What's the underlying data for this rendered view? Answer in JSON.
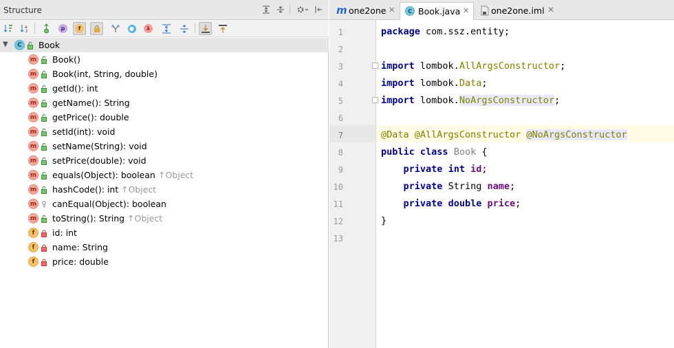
{
  "structure": {
    "title": "Structure",
    "header_tools": [
      "expand-icon",
      "collapse-icon",
      "settings-icon",
      "hide-icon"
    ],
    "toolbar": [
      "sort-visibility-icon",
      "sort-alpha-icon",
      "show-inherited-icon",
      "show-properties-icon",
      "show-fields-icon",
      "show-non-public-icon",
      "show-anonymous-icon",
      "show-lambdas-icon",
      "autoscroll-to-source-icon",
      "autoscroll-from-source-icon",
      "expand-all-icon",
      "collapse-all-icon"
    ],
    "tree": {
      "class_name": "Book",
      "members": [
        {
          "kind": "m",
          "label": "Book()",
          "inherited": "",
          "visibility": "public"
        },
        {
          "kind": "m",
          "label": "Book(int, String, double)",
          "inherited": "",
          "visibility": "public"
        },
        {
          "kind": "m",
          "label": "getId(): int",
          "inherited": "",
          "visibility": "public"
        },
        {
          "kind": "m",
          "label": "getName(): String",
          "inherited": "",
          "visibility": "public"
        },
        {
          "kind": "m",
          "label": "getPrice(): double",
          "inherited": "",
          "visibility": "public"
        },
        {
          "kind": "m",
          "label": "setId(int): void",
          "inherited": "",
          "visibility": "public"
        },
        {
          "kind": "m",
          "label": "setName(String): void",
          "inherited": "",
          "visibility": "public"
        },
        {
          "kind": "m",
          "label": "setPrice(double): void",
          "inherited": "",
          "visibility": "public"
        },
        {
          "kind": "m",
          "label": "equals(Object): boolean",
          "inherited": "↑Object",
          "visibility": "public"
        },
        {
          "kind": "m",
          "label": "hashCode(): int",
          "inherited": "↑Object",
          "visibility": "public"
        },
        {
          "kind": "m",
          "label": "canEqual(Object): boolean",
          "inherited": "",
          "visibility": "protected"
        },
        {
          "kind": "m",
          "label": "toString(): String",
          "inherited": "↑Object",
          "visibility": "public"
        },
        {
          "kind": "f",
          "label": "id: int",
          "inherited": "",
          "visibility": "private"
        },
        {
          "kind": "f",
          "label": "name: String",
          "inherited": "",
          "visibility": "private"
        },
        {
          "kind": "f",
          "label": "price: double",
          "inherited": "",
          "visibility": "private"
        }
      ]
    }
  },
  "editor": {
    "tabs": [
      {
        "label": "one2one",
        "icon": "m",
        "active": false
      },
      {
        "label": "Book.java",
        "icon": "c",
        "active": true
      },
      {
        "label": "one2one.iml",
        "icon": "file",
        "active": false
      }
    ],
    "line_numbers": [
      "1",
      "2",
      "3",
      "4",
      "5",
      "6",
      "7",
      "8",
      "9",
      "10",
      "11",
      "12",
      "13"
    ],
    "current_line": "7",
    "code": {
      "l1_kw": "package",
      "l1_rest": " com.ssz.entity;",
      "l3_kw": "import",
      "l3_pkg": " lombok.",
      "l3_cls": "AllArgsConstructor",
      "l3_end": ";",
      "l4_kw": "import",
      "l4_pkg": " lombok.",
      "l4_cls": "Data",
      "l4_end": ";",
      "l5_kw": "import",
      "l5_pkg": " lombok.",
      "l5_cls": "NoArgsConstructor",
      "l5_end": ";",
      "l7_a1": "@Data",
      "l7_a2": "@AllArgsConstructor",
      "l7_a3": "@NoArgsConstructor",
      "l8_kw1": "public",
      "l8_kw2": "class",
      "l8_name": "Book",
      "l8_end": " {",
      "l9_kw1": "private",
      "l9_kw2": "int",
      "l9_fld": "id",
      "l9_end": ";",
      "l10_kw1": "private",
      "l10_type": "String",
      "l10_fld": "name",
      "l10_end": ";",
      "l11_kw1": "private",
      "l11_kw2": "double",
      "l11_fld": "price",
      "l11_end": ";",
      "l12": "}"
    }
  }
}
